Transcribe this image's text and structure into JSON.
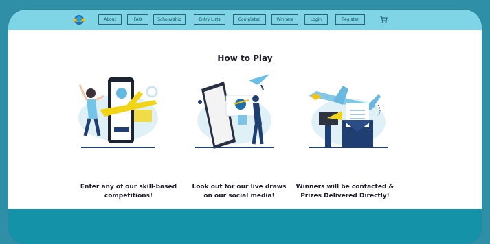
{
  "nav": {
    "items": [
      "About",
      "FAQ",
      "Scholarship",
      "Entry Lists",
      "Completed",
      "Winners",
      "Login",
      "Register"
    ],
    "cart_icon": "cart-icon"
  },
  "main": {
    "title": "How to Play",
    "steps": [
      {
        "line1": "Enter any of our skill-based",
        "line2": "competitions!"
      },
      {
        "line1": "Look out for our live draws",
        "line2": "on our social media!"
      },
      {
        "line1": "Winners will be contacted &",
        "line2": "Prizes Delivered Directly!"
      }
    ]
  },
  "colors": {
    "navbar": "#7fd5e6",
    "footer": "#1493a8",
    "page_bg": "#2f8fa6"
  }
}
